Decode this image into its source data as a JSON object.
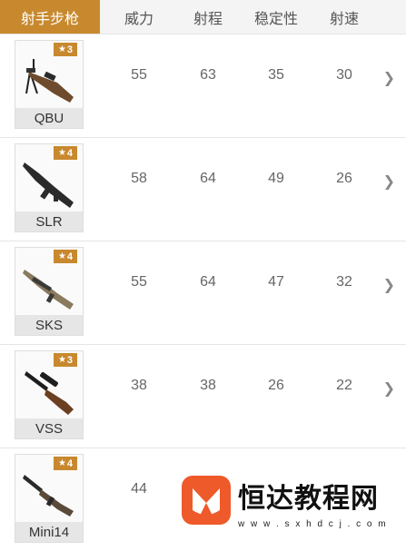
{
  "header": {
    "category_tab": "射手步枪",
    "columns": [
      "威力",
      "射程",
      "稳定性",
      "射速"
    ]
  },
  "weapons": [
    {
      "name": "QBU",
      "stars": "3",
      "power": "55",
      "range": "63",
      "stability": "35",
      "rate": "30"
    },
    {
      "name": "SLR",
      "stars": "4",
      "power": "58",
      "range": "64",
      "stability": "49",
      "rate": "26"
    },
    {
      "name": "SKS",
      "stars": "4",
      "power": "55",
      "range": "64",
      "stability": "47",
      "rate": "32"
    },
    {
      "name": "VSS",
      "stars": "3",
      "power": "38",
      "range": "38",
      "stability": "26",
      "rate": "22"
    },
    {
      "name": "Mini14",
      "stars": "4",
      "power": "44",
      "range": "",
      "stability": "",
      "rate": ""
    }
  ],
  "watermark": {
    "text": "恒达教程网",
    "url": "w w w . s x h d c j . c o m"
  },
  "colors": {
    "accent": "#c8892e",
    "logo": "#ee5a2a"
  }
}
